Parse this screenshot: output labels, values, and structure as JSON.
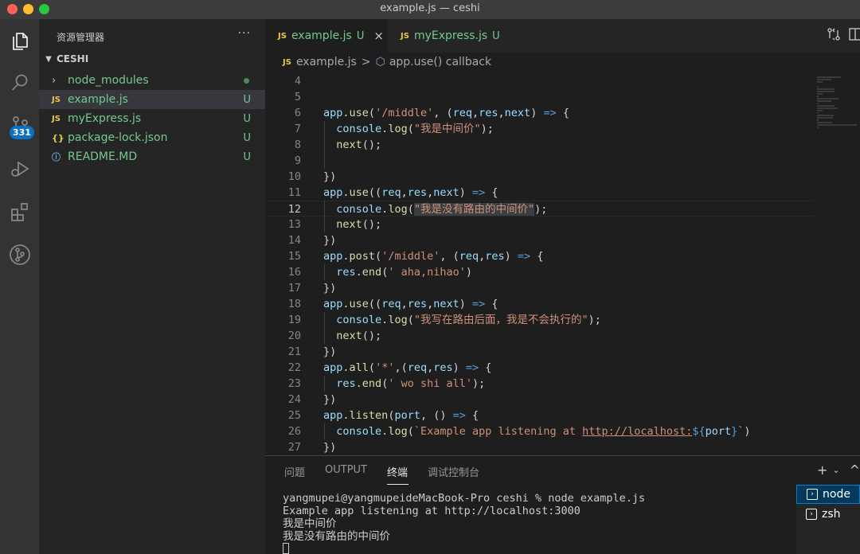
{
  "window": {
    "title": "example.js — ceshi"
  },
  "activity": {
    "badge": "331"
  },
  "sidebar": {
    "header": "资源管理器",
    "more": "···",
    "section": "CESHI",
    "items": [
      {
        "label": "node_modules",
        "icon": "chevron-right-icon",
        "status": ""
      },
      {
        "label": "example.js",
        "icon": "js-file-icon",
        "icon_text": "JS",
        "status": "U"
      },
      {
        "label": "myExpress.js",
        "icon": "js-file-icon",
        "icon_text": "JS",
        "status": "U"
      },
      {
        "label": "package-lock.json",
        "icon": "json-file-icon",
        "icon_text": "{}",
        "status": "U"
      },
      {
        "label": "README.MD",
        "icon": "info-icon",
        "icon_text": "ⓘ",
        "status": "U"
      }
    ]
  },
  "tabs": [
    {
      "icon_text": "JS",
      "label": "example.js",
      "status": "U",
      "close": "×"
    },
    {
      "icon_text": "JS",
      "label": "myExpress.js",
      "status": "U"
    }
  ],
  "breadcrumb": {
    "icon_text": "JS",
    "file": "example.js",
    "sep": ">",
    "symbol": "app.use() callback"
  },
  "code": {
    "current_line": "12",
    "lines": [
      {
        "n": "4",
        "tokens": []
      },
      {
        "n": "5",
        "tokens": []
      },
      {
        "n": "6",
        "tokens": [
          [
            "vr",
            "app"
          ],
          [
            "pn",
            "."
          ],
          [
            "fn",
            "use"
          ],
          [
            "pn",
            "("
          ],
          [
            "st",
            "'/middle'"
          ],
          [
            "pn",
            ", ("
          ],
          [
            "vr",
            "req"
          ],
          [
            "pn",
            ","
          ],
          [
            "vr",
            "res"
          ],
          [
            "pn",
            ","
          ],
          [
            "vr",
            "next"
          ],
          [
            "pn",
            ") "
          ],
          [
            "kw",
            "=>"
          ],
          [
            "pn",
            " {"
          ]
        ]
      },
      {
        "n": "7",
        "tokens": [
          [
            "pn",
            "  "
          ],
          [
            "vr",
            "console"
          ],
          [
            "pn",
            "."
          ],
          [
            "fn",
            "log"
          ],
          [
            "pn",
            "("
          ],
          [
            "st",
            "\"我是中间价\""
          ],
          [
            "pn",
            ");"
          ]
        ]
      },
      {
        "n": "8",
        "tokens": [
          [
            "pn",
            "  "
          ],
          [
            "fn",
            "next"
          ],
          [
            "pn",
            "();"
          ]
        ]
      },
      {
        "n": "9",
        "tokens": []
      },
      {
        "n": "10",
        "tokens": [
          [
            "pn",
            "})"
          ]
        ]
      },
      {
        "n": "11",
        "tokens": [
          [
            "vr",
            "app"
          ],
          [
            "pn",
            "."
          ],
          [
            "fn",
            "use"
          ],
          [
            "pn",
            "(("
          ],
          [
            "vr",
            "req"
          ],
          [
            "pn",
            ","
          ],
          [
            "vr",
            "res"
          ],
          [
            "pn",
            ","
          ],
          [
            "vr",
            "next"
          ],
          [
            "pn",
            ") "
          ],
          [
            "kw",
            "=>"
          ],
          [
            "pn",
            " {"
          ]
        ]
      },
      {
        "n": "12",
        "tokens": [
          [
            "pn",
            "  "
          ],
          [
            "vr",
            "console"
          ],
          [
            "pn",
            "."
          ],
          [
            "fn",
            "log"
          ],
          [
            "pn",
            "("
          ],
          [
            "st",
            "\"我是没有路由的中间价\""
          ],
          [
            "pn",
            ");"
          ]
        ]
      },
      {
        "n": "13",
        "tokens": [
          [
            "pn",
            "  "
          ],
          [
            "fn",
            "next"
          ],
          [
            "pn",
            "();"
          ]
        ]
      },
      {
        "n": "14",
        "tokens": [
          [
            "pn",
            "})"
          ]
        ]
      },
      {
        "n": "15",
        "tokens": [
          [
            "vr",
            "app"
          ],
          [
            "pn",
            "."
          ],
          [
            "fn",
            "post"
          ],
          [
            "pn",
            "("
          ],
          [
            "st",
            "'/middle'"
          ],
          [
            "pn",
            ", ("
          ],
          [
            "vr",
            "req"
          ],
          [
            "pn",
            ","
          ],
          [
            "vr",
            "res"
          ],
          [
            "pn",
            ") "
          ],
          [
            "kw",
            "=>"
          ],
          [
            "pn",
            " {"
          ]
        ]
      },
      {
        "n": "16",
        "tokens": [
          [
            "pn",
            "  "
          ],
          [
            "vr",
            "res"
          ],
          [
            "pn",
            "."
          ],
          [
            "fn",
            "end"
          ],
          [
            "pn",
            "("
          ],
          [
            "st",
            "' aha,nihao'"
          ],
          [
            "pn",
            ")"
          ]
        ]
      },
      {
        "n": "17",
        "tokens": [
          [
            "pn",
            "})"
          ]
        ]
      },
      {
        "n": "18",
        "tokens": [
          [
            "vr",
            "app"
          ],
          [
            "pn",
            "."
          ],
          [
            "fn",
            "use"
          ],
          [
            "pn",
            "(("
          ],
          [
            "vr",
            "req"
          ],
          [
            "pn",
            ","
          ],
          [
            "vr",
            "res"
          ],
          [
            "pn",
            ","
          ],
          [
            "vr",
            "next"
          ],
          [
            "pn",
            ") "
          ],
          [
            "kw",
            "=>"
          ],
          [
            "pn",
            " {"
          ]
        ]
      },
      {
        "n": "19",
        "tokens": [
          [
            "pn",
            "  "
          ],
          [
            "vr",
            "console"
          ],
          [
            "pn",
            "."
          ],
          [
            "fn",
            "log"
          ],
          [
            "pn",
            "("
          ],
          [
            "st",
            "\"我写在路由后面，我是不会执行的\""
          ],
          [
            "pn",
            ");"
          ]
        ]
      },
      {
        "n": "20",
        "tokens": [
          [
            "pn",
            "  "
          ],
          [
            "fn",
            "next"
          ],
          [
            "pn",
            "();"
          ]
        ]
      },
      {
        "n": "21",
        "tokens": [
          [
            "pn",
            "})"
          ]
        ]
      },
      {
        "n": "22",
        "tokens": [
          [
            "vr",
            "app"
          ],
          [
            "pn",
            "."
          ],
          [
            "fn",
            "all"
          ],
          [
            "pn",
            "("
          ],
          [
            "st",
            "'*'"
          ],
          [
            "pn",
            ",("
          ],
          [
            "vr",
            "req"
          ],
          [
            "pn",
            ","
          ],
          [
            "vr",
            "res"
          ],
          [
            "pn",
            ") "
          ],
          [
            "kw",
            "=>"
          ],
          [
            "pn",
            " {"
          ]
        ]
      },
      {
        "n": "23",
        "tokens": [
          [
            "pn",
            "  "
          ],
          [
            "vr",
            "res"
          ],
          [
            "pn",
            "."
          ],
          [
            "fn",
            "end"
          ],
          [
            "pn",
            "("
          ],
          [
            "st",
            "' wo shi all'"
          ],
          [
            "pn",
            ");"
          ]
        ]
      },
      {
        "n": "24",
        "tokens": [
          [
            "pn",
            "})"
          ]
        ]
      },
      {
        "n": "25",
        "tokens": [
          [
            "vr",
            "app"
          ],
          [
            "pn",
            "."
          ],
          [
            "fn",
            "listen"
          ],
          [
            "pn",
            "("
          ],
          [
            "vr",
            "port"
          ],
          [
            "pn",
            ", () "
          ],
          [
            "kw",
            "=>"
          ],
          [
            "pn",
            " {"
          ]
        ]
      },
      {
        "n": "26",
        "tokens": [
          [
            "pn",
            "  "
          ],
          [
            "vr",
            "console"
          ],
          [
            "pn",
            "."
          ],
          [
            "fn",
            "log"
          ],
          [
            "pn",
            "("
          ],
          [
            "st",
            "`Example app listening at "
          ],
          [
            "lk",
            "http://localhost:"
          ],
          [
            "tp",
            "${"
          ],
          [
            "vr",
            "port"
          ],
          [
            "tp",
            "}"
          ],
          [
            "st",
            "`"
          ],
          [
            "pn",
            ")"
          ]
        ]
      },
      {
        "n": "27",
        "tokens": [
          [
            "pn",
            "})"
          ]
        ]
      }
    ]
  },
  "panel": {
    "tabs": [
      "问题",
      "OUTPUT",
      "终端",
      "调试控制台"
    ],
    "active_tab": "终端",
    "actions": {
      "add": "+",
      "dropdown": "⌄",
      "collapse": "^"
    },
    "terminal_lines": [
      "yangmupei@yangmupeideMacBook-Pro ceshi % node example.js",
      "Example app listening at http://localhost:3000",
      "我是中间价",
      "我是没有路由的中间价"
    ],
    "terminals": [
      {
        "label": "node",
        "selected": true
      },
      {
        "label": "zsh",
        "selected": false
      }
    ]
  }
}
